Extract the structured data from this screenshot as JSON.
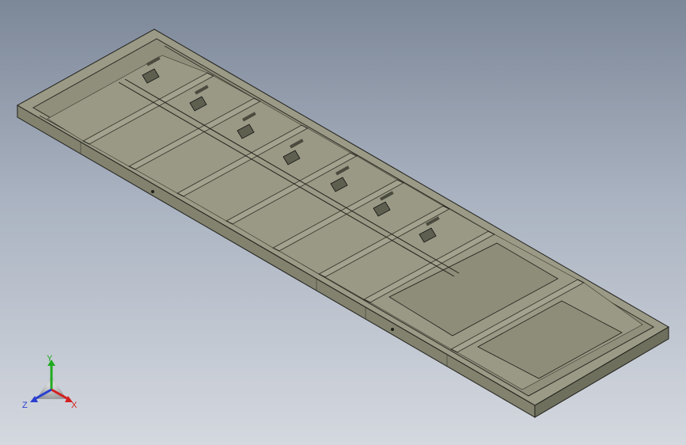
{
  "viewport": {
    "background_top": "#7c8798",
    "background_bottom": "#d4d8df"
  },
  "model": {
    "icon": "sheet-metal-frame-assembly",
    "colors": {
      "top_face": "#9b9a86",
      "front_face": "#82826f",
      "side_face": "#6f6f5e",
      "panel": "#8f8e7b",
      "edge": "#1f1f1a"
    }
  },
  "triad": {
    "x_label": "X",
    "y_label": "Y",
    "z_label": "Z",
    "x_color": "#d42020",
    "y_color": "#1faa1f",
    "z_color": "#2a3fd0"
  }
}
